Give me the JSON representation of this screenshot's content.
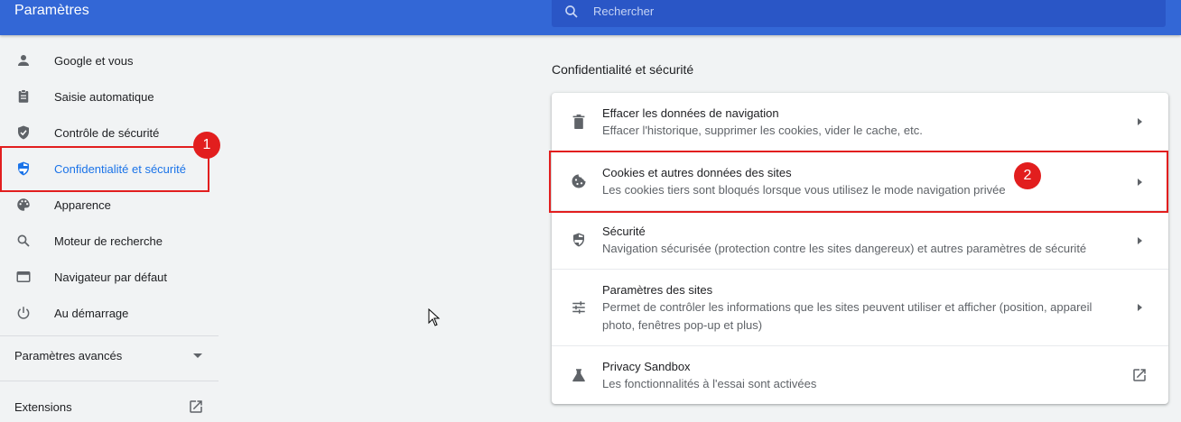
{
  "app": {
    "title": "Paramètres"
  },
  "search": {
    "placeholder": "Rechercher"
  },
  "sidebar": {
    "items": [
      {
        "label": "Google et vous",
        "icon": "person-icon"
      },
      {
        "label": "Saisie automatique",
        "icon": "clipboard-icon"
      },
      {
        "label": "Contrôle de sécurité",
        "icon": "shield-check-icon"
      },
      {
        "label": "Confidentialité et sécurité",
        "icon": "shield-half-icon",
        "active": true
      },
      {
        "label": "Apparence",
        "icon": "palette-icon"
      },
      {
        "label": "Moteur de recherche",
        "icon": "search-icon"
      },
      {
        "label": "Navigateur par défaut",
        "icon": "browser-window-icon"
      },
      {
        "label": "Au démarrage",
        "icon": "power-icon"
      }
    ],
    "advanced_label": "Paramètres avancés",
    "extensions_label": "Extensions"
  },
  "main": {
    "section_title": "Confidentialité et sécurité",
    "rows": [
      {
        "title": "Effacer les données de navigation",
        "desc": "Effacer l'historique, supprimer les cookies, vider le cache, etc.",
        "icon": "trash-icon"
      },
      {
        "title": "Cookies et autres données des sites",
        "desc": "Les cookies tiers sont bloqués lorsque vous utilisez le mode navigation privée",
        "icon": "cookie-icon"
      },
      {
        "title": "Sécurité",
        "desc": "Navigation sécurisée (protection contre les sites dangereux) et autres paramètres de sécurité",
        "icon": "shield-icon"
      },
      {
        "title": "Paramètres des sites",
        "desc": "Permet de contrôler les informations que les sites peuvent utiliser et afficher (position, appareil photo, fenêtres pop-up et plus)",
        "icon": "sliders-icon"
      },
      {
        "title": "Privacy Sandbox",
        "desc": "Les fonctionnalités à l'essai sont activées",
        "icon": "flask-icon"
      }
    ]
  },
  "annotations": {
    "badge1": "1",
    "badge2": "2",
    "highlight_color": "#e21e1e"
  },
  "colors": {
    "header": "#3367d6",
    "accent": "#1a73e8",
    "background": "#f1f3f4"
  }
}
